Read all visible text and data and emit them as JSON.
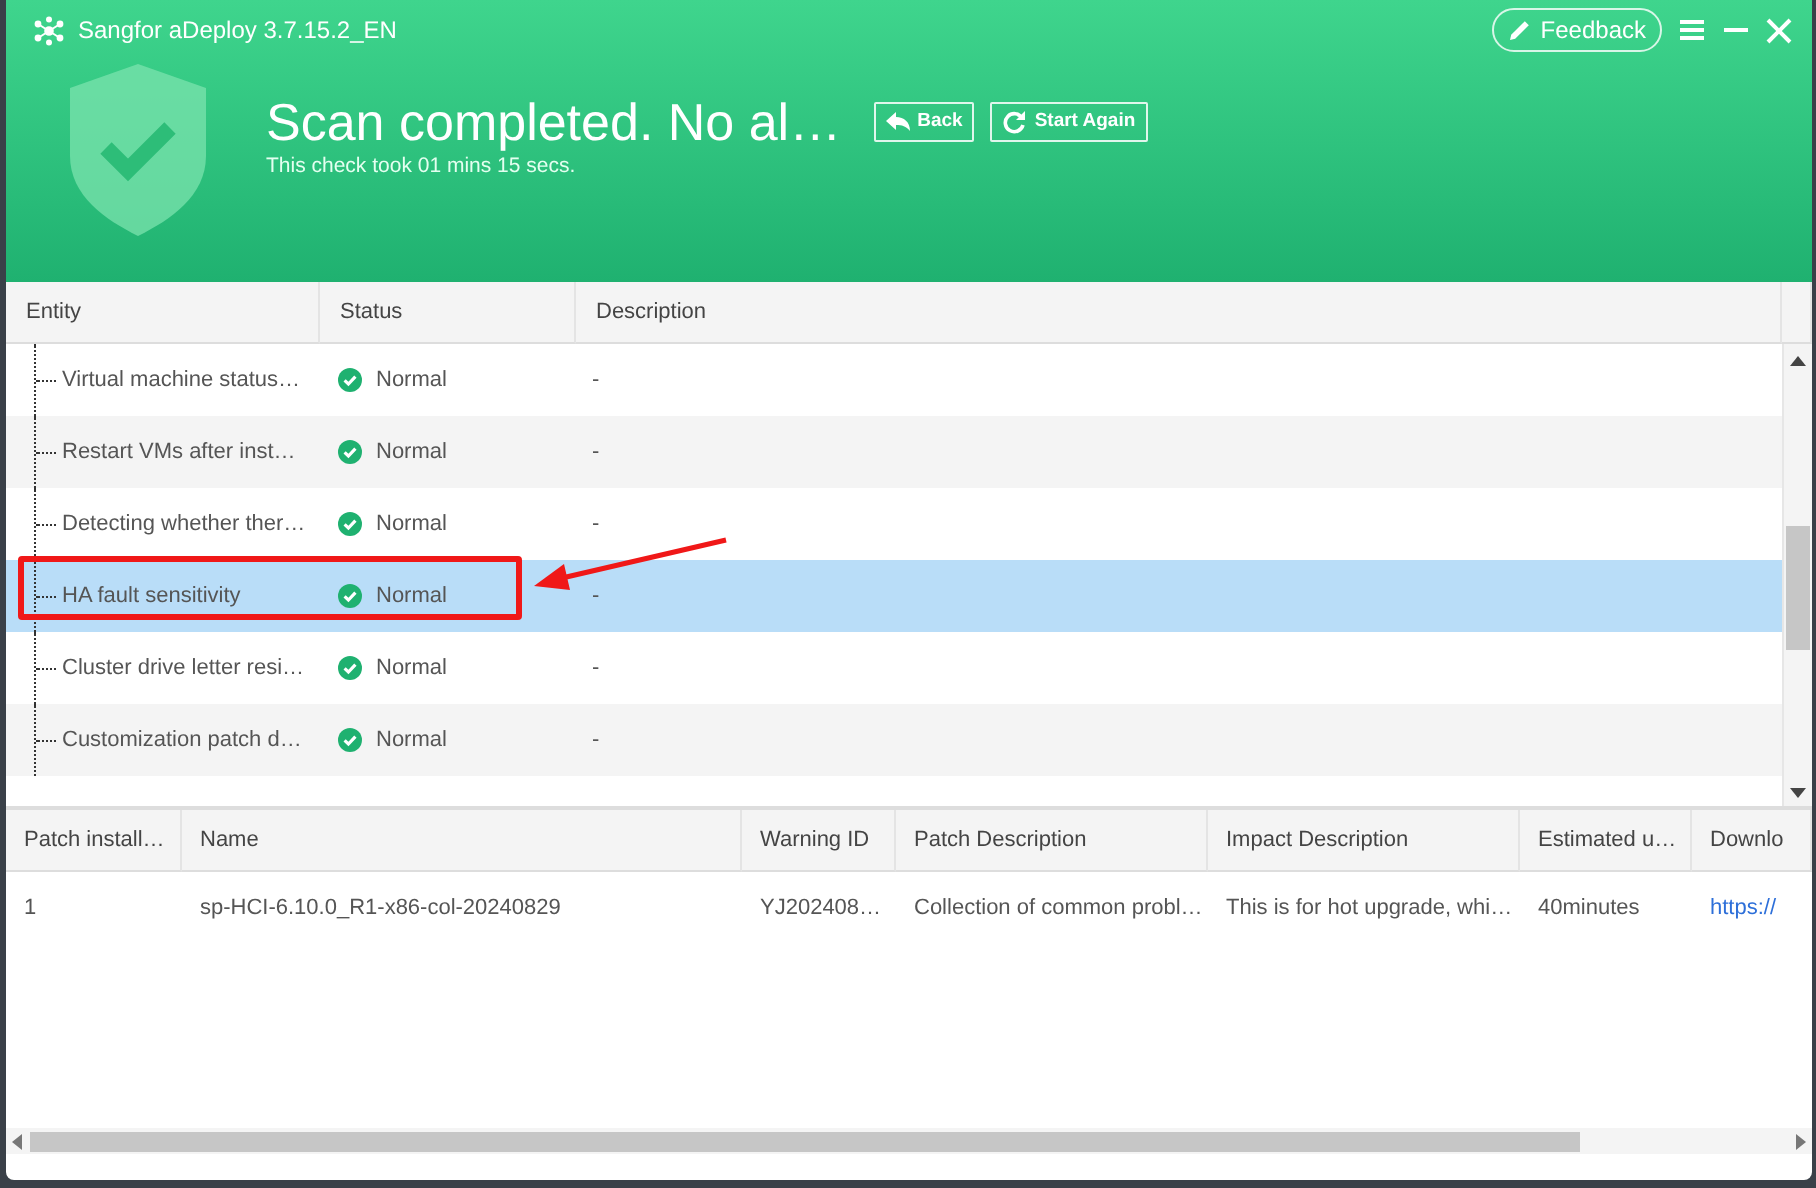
{
  "window": {
    "title": "Sangfor aDeploy 3.7.15.2_EN",
    "feedback_button": "Feedback"
  },
  "summary": {
    "heading": "Scan completed. No al…",
    "subtext": "This check took 01 mins 15 secs.",
    "buttons": [
      {
        "label": "Back",
        "kind": "back"
      },
      {
        "label": "Start Again",
        "kind": "restart"
      }
    ]
  },
  "checks_table": {
    "columns": [
      "Entity",
      "Status",
      "Description"
    ],
    "rows": [
      {
        "entity": "Virtual machine status…",
        "status": "Normal",
        "description": "-",
        "selected": false
      },
      {
        "entity": "Restart VMs after inst…",
        "status": "Normal",
        "description": "-",
        "selected": false
      },
      {
        "entity": "Detecting whether ther…",
        "status": "Normal",
        "description": "-",
        "selected": false
      },
      {
        "entity": "HA fault sensitivity",
        "status": "Normal",
        "description": "-",
        "selected": true
      },
      {
        "entity": "Cluster drive letter resi…",
        "status": "Normal",
        "description": "-",
        "selected": false
      },
      {
        "entity": "Customization patch d…",
        "status": "Normal",
        "description": "-",
        "selected": false
      }
    ]
  },
  "patch_table": {
    "columns": [
      "Patch install…",
      "Name",
      "Warning ID",
      "Patch Description",
      "Impact Description",
      "Estimated u…",
      "Downlo"
    ],
    "rows": [
      {
        "cells": [
          "1",
          "sp-HCI-6.10.0_R1-x86-col-20240829",
          "YJ202408…",
          "Collection of common probl…",
          "This is for hot upgrade, whi…",
          "40minutes"
        ],
        "link": "https://"
      }
    ]
  }
}
